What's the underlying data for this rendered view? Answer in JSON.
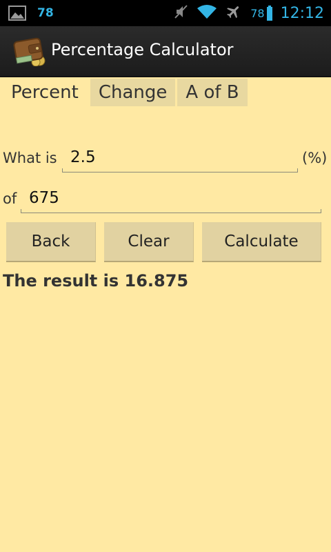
{
  "status_bar": {
    "notification_count": "78",
    "battery_level": "78",
    "time": "12:12",
    "icons": [
      "gallery-icon",
      "mute-icon",
      "wifi-icon",
      "airplane-icon",
      "battery-icon"
    ],
    "accent_color": "#33B5E5"
  },
  "action_bar": {
    "title": "Percentage Calculator",
    "icon": "wallet-icon"
  },
  "tabs": [
    {
      "label": "Percent",
      "active": true
    },
    {
      "label": "Change",
      "active": false
    },
    {
      "label": "A of B",
      "active": false
    }
  ],
  "form": {
    "what_is_label": "What is",
    "percent_value": "2.5",
    "percent_suffix": "(%)",
    "of_label": "of",
    "base_value": "675"
  },
  "buttons": {
    "back": "Back",
    "clear": "Clear",
    "calculate": "Calculate"
  },
  "result_text": "The result is 16.875",
  "colors": {
    "background": "#FFE9A3",
    "button": "#E1D2A1",
    "tab_inactive": "#E8D8A0"
  }
}
